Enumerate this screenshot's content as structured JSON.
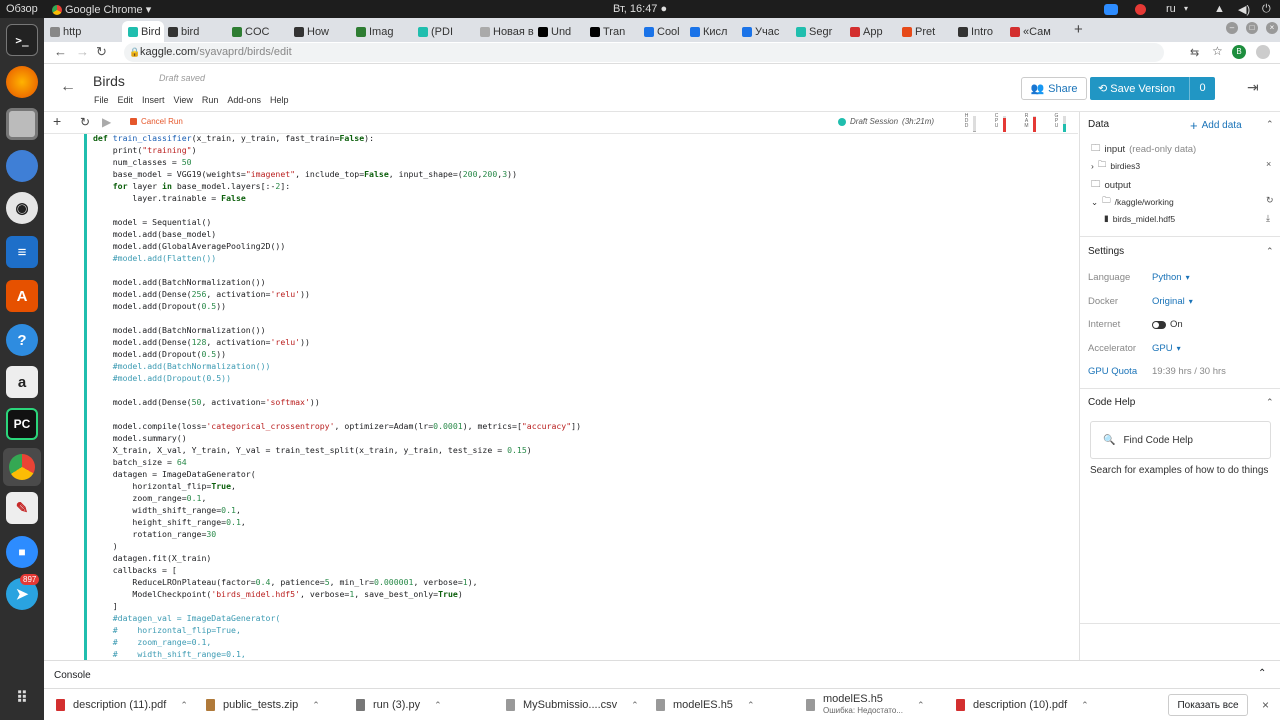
{
  "system": {
    "overview": "Обзор",
    "app": "Google Chrome ▾",
    "clock": "Вт, 16:47 ●",
    "lang": "ru",
    "notify_count": "897"
  },
  "tabs": [
    {
      "label": "http",
      "color": "#888",
      "active": false
    },
    {
      "label": "Bird",
      "color": "#20beae",
      "active": true
    },
    {
      "label": "bird",
      "color": "#333",
      "active": false
    },
    {
      "label": "COC",
      "color": "#2e7d32",
      "active": false
    },
    {
      "label": "How",
      "color": "#333",
      "active": false
    },
    {
      "label": "Imag",
      "color": "#2e7d32",
      "active": false
    },
    {
      "label": "(PDI",
      "color": "#20beae",
      "active": false
    },
    {
      "label": "Новая в",
      "color": "#aaa",
      "active": false
    },
    {
      "label": "Und",
      "color": "#000",
      "active": false
    },
    {
      "label": "Tran",
      "color": "#000",
      "active": false
    },
    {
      "label": "Cool",
      "color": "#1a73e8",
      "active": false
    },
    {
      "label": "Кисл",
      "color": "#1a73e8",
      "active": false
    },
    {
      "label": "Учас",
      "color": "#1a73e8",
      "active": false
    },
    {
      "label": "Segr",
      "color": "#20beae",
      "active": false
    },
    {
      "label": "App",
      "color": "#d32f2f",
      "active": false
    },
    {
      "label": "Pret",
      "color": "#e64a19",
      "active": false
    },
    {
      "label": "Intro",
      "color": "#333",
      "active": false
    },
    {
      "label": "«Сам",
      "color": "#d32f2f",
      "active": false
    }
  ],
  "omnibox": {
    "domain": "kaggle.com",
    "path": "/syavaprd/birds/edit",
    "profile": "B"
  },
  "kernel": {
    "title": "Birds",
    "status": "Draft saved",
    "menu": [
      "File",
      "Edit",
      "Insert",
      "View",
      "Run",
      "Add-ons",
      "Help"
    ],
    "share": "Share",
    "save_version": "Save Version",
    "version_count": "0"
  },
  "toolbar": {
    "cancel": "Cancel Run",
    "session": "Draft Session",
    "session_time": "(3h:21m)",
    "meters": [
      {
        "label": "HDD",
        "fill": 0.05,
        "color": "#aaa"
      },
      {
        "label": "CPU",
        "fill": 0.9,
        "color": "#e53935"
      },
      {
        "label": "RAM",
        "fill": 0.95,
        "color": "#e53935"
      },
      {
        "label": "GPU",
        "fill": 0.5,
        "color": "#20beae"
      }
    ]
  },
  "code_lines": [
    [
      [
        "def ",
        "kw"
      ],
      [
        "train_classifier",
        "fn"
      ],
      [
        "(x_train, y_train, fast_train=",
        ""
      ],
      [
        "False",
        "kw"
      ],
      [
        "):",
        ""
      ]
    ],
    [
      [
        "    print(",
        ""
      ],
      [
        "\"training\"",
        "st"
      ],
      [
        ")",
        ""
      ]
    ],
    [
      [
        "    num_classes = ",
        ""
      ],
      [
        "50",
        "nm"
      ]
    ],
    [
      [
        "    base_model = VGG19(weights=",
        ""
      ],
      [
        "\"imagenet\"",
        "st"
      ],
      [
        ", include_top=",
        ""
      ],
      [
        "False",
        "kw"
      ],
      [
        ", input_shape=(",
        ""
      ],
      [
        "200",
        "nm"
      ],
      [
        ",",
        ""
      ],
      [
        "200",
        "nm"
      ],
      [
        ",",
        ""
      ],
      [
        "3",
        "nm"
      ],
      [
        "))",
        ""
      ]
    ],
    [
      [
        "    ",
        ""
      ],
      [
        "for ",
        "kw"
      ],
      [
        "layer ",
        ""
      ],
      [
        "in ",
        "kw"
      ],
      [
        "base_model.layers[:-",
        ""
      ],
      [
        "2",
        "nm"
      ],
      [
        "]:",
        ""
      ]
    ],
    [
      [
        "        layer.trainable = ",
        ""
      ],
      [
        "False",
        "kw"
      ]
    ],
    [
      [
        "",
        ""
      ]
    ],
    [
      [
        "    model = Sequential()",
        ""
      ]
    ],
    [
      [
        "    model.add(base_model)",
        ""
      ]
    ],
    [
      [
        "    model.add(GlobalAveragePooling2D())",
        ""
      ]
    ],
    [
      [
        "    #model.add(Flatten())",
        "cm"
      ]
    ],
    [
      [
        "",
        ""
      ]
    ],
    [
      [
        "    model.add(BatchNormalization())",
        ""
      ]
    ],
    [
      [
        "    model.add(Dense(",
        ""
      ],
      [
        "256",
        "nm"
      ],
      [
        ", activation=",
        ""
      ],
      [
        "'relu'",
        "st"
      ],
      [
        "))",
        ""
      ]
    ],
    [
      [
        "    model.add(Dropout(",
        ""
      ],
      [
        "0.5",
        "nm"
      ],
      [
        "))",
        ""
      ]
    ],
    [
      [
        "",
        ""
      ]
    ],
    [
      [
        "    model.add(BatchNormalization())",
        ""
      ]
    ],
    [
      [
        "    model.add(Dense(",
        ""
      ],
      [
        "128",
        "nm"
      ],
      [
        ", activation=",
        ""
      ],
      [
        "'relu'",
        "st"
      ],
      [
        "))",
        ""
      ]
    ],
    [
      [
        "    model.add(Dropout(",
        ""
      ],
      [
        "0.5",
        "nm"
      ],
      [
        "))",
        ""
      ]
    ],
    [
      [
        "    #model.add(BatchNormalization())",
        "cm"
      ]
    ],
    [
      [
        "    #model.add(Dropout(0.5))",
        "cm"
      ]
    ],
    [
      [
        "",
        ""
      ]
    ],
    [
      [
        "    model.add(Dense(",
        ""
      ],
      [
        "50",
        "nm"
      ],
      [
        ", activation=",
        ""
      ],
      [
        "'softmax'",
        "st"
      ],
      [
        "))",
        ""
      ]
    ],
    [
      [
        "",
        ""
      ]
    ],
    [
      [
        "    model.compile(loss=",
        ""
      ],
      [
        "'categorical_crossentropy'",
        "st"
      ],
      [
        ", optimizer=Adam(lr=",
        ""
      ],
      [
        "0.0001",
        "nm"
      ],
      [
        "), metrics=[",
        ""
      ],
      [
        "\"accuracy\"",
        "st"
      ],
      [
        "])",
        ""
      ]
    ],
    [
      [
        "    model.summary()",
        ""
      ]
    ],
    [
      [
        "    X_train, X_val, Y_train, Y_val = train_test_split(x_train, y_train, test_size = ",
        ""
      ],
      [
        "0.15",
        "nm"
      ],
      [
        ")",
        ""
      ]
    ],
    [
      [
        "    batch_size = ",
        ""
      ],
      [
        "64",
        "nm"
      ]
    ],
    [
      [
        "    datagen = ImageDataGenerator(",
        ""
      ]
    ],
    [
      [
        "        horizontal_flip=",
        ""
      ],
      [
        "True",
        "kw"
      ],
      [
        ",",
        ""
      ]
    ],
    [
      [
        "        zoom_range=",
        ""
      ],
      [
        "0.1",
        "nm"
      ],
      [
        ",",
        ""
      ]
    ],
    [
      [
        "        width_shift_range=",
        ""
      ],
      [
        "0.1",
        "nm"
      ],
      [
        ",",
        ""
      ]
    ],
    [
      [
        "        height_shift_range=",
        ""
      ],
      [
        "0.1",
        "nm"
      ],
      [
        ",",
        ""
      ]
    ],
    [
      [
        "        rotation_range=",
        ""
      ],
      [
        "30",
        "nm"
      ]
    ],
    [
      [
        "    )",
        ""
      ]
    ],
    [
      [
        "    datagen.fit(X_train)",
        ""
      ]
    ],
    [
      [
        "    callbacks = [",
        ""
      ]
    ],
    [
      [
        "        ReduceLROnPlateau(factor=",
        ""
      ],
      [
        "0.4",
        "nm"
      ],
      [
        ", patience=",
        ""
      ],
      [
        "5",
        "nm"
      ],
      [
        ", min_lr=",
        ""
      ],
      [
        "0.000001",
        "nm"
      ],
      [
        ", verbose=",
        ""
      ],
      [
        "1",
        "nm"
      ],
      [
        "),",
        ""
      ]
    ],
    [
      [
        "        ModelCheckpoint(",
        ""
      ],
      [
        "'birds_midel.hdf5'",
        "st"
      ],
      [
        ", verbose=",
        ""
      ],
      [
        "1",
        "nm"
      ],
      [
        ", save_best_only=",
        ""
      ],
      [
        "True",
        "kw"
      ],
      [
        ")",
        ""
      ]
    ],
    [
      [
        "    ]",
        ""
      ]
    ],
    [
      [
        "    #datagen_val = ImageDataGenerator(",
        "cm"
      ]
    ],
    [
      [
        "    #    horizontal_flip=True,",
        "cm"
      ]
    ],
    [
      [
        "    #    zoom_range=0.1,",
        "cm"
      ]
    ],
    [
      [
        "    #    width_shift_range=0.1,",
        "cm"
      ]
    ]
  ],
  "sidebar": {
    "data_title": "Data",
    "add_data": "Add data",
    "input": "input",
    "input_note": "(read-only data)",
    "birdies": "birdies3",
    "output": "output",
    "working": "/kaggle/working",
    "file": "birds_midel.hdf5",
    "settings_title": "Settings",
    "language_label": "Language",
    "language": "Python",
    "docker_label": "Docker",
    "docker": "Original",
    "internet_label": "Internet",
    "internet": "On",
    "accel_label": "Accelerator",
    "accel": "GPU",
    "quota_label": "GPU Quota",
    "quota": "19:39 hrs / 30 hrs",
    "codehelp_title": "Code Help",
    "find": "Find Code Help",
    "search_desc": "Search for examples of how to do things"
  },
  "console": {
    "label": "Console"
  },
  "downloads": [
    {
      "name": "description (11).pdf",
      "sub": "",
      "color": "#d32f2f"
    },
    {
      "name": "public_tests.zip",
      "sub": "",
      "color": "#b07a3a"
    },
    {
      "name": "run (3).py",
      "sub": "",
      "color": "#777"
    },
    {
      "name": "MySubmissio....csv",
      "sub": "",
      "color": "#999"
    },
    {
      "name": "modelES.h5",
      "sub": "",
      "color": "#999"
    },
    {
      "name": "modelES.h5",
      "sub": "Ошибка: Недостато...",
      "color": "#999"
    },
    {
      "name": "description (10).pdf",
      "sub": "",
      "color": "#d32f2f"
    }
  ],
  "show_all": "Показать все"
}
